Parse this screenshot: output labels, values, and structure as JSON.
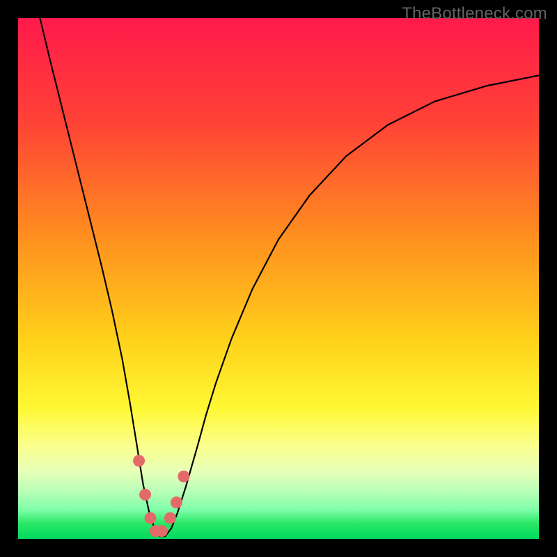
{
  "watermark": "TheBottleneck.com",
  "chart_data": {
    "type": "line",
    "title": "",
    "xlabel": "",
    "ylabel": "",
    "xlim": [
      0,
      1
    ],
    "ylim": [
      0,
      100
    ],
    "background_gradient": {
      "stops": [
        {
          "pos": 0.0,
          "color": "#ff1a4b"
        },
        {
          "pos": 0.2,
          "color": "#ff4236"
        },
        {
          "pos": 0.42,
          "color": "#ff8f1f"
        },
        {
          "pos": 0.62,
          "color": "#ffd21a"
        },
        {
          "pos": 0.75,
          "color": "#fff835"
        },
        {
          "pos": 0.82,
          "color": "#fbff8c"
        },
        {
          "pos": 0.87,
          "color": "#e7ffb7"
        },
        {
          "pos": 0.91,
          "color": "#b7ffb7"
        },
        {
          "pos": 0.945,
          "color": "#7dfda8"
        },
        {
          "pos": 0.97,
          "color": "#2be867"
        },
        {
          "pos": 1.0,
          "color": "#00d85e"
        }
      ]
    },
    "series": [
      {
        "name": "bottleneck-curve",
        "x": [
          0.042,
          0.06,
          0.08,
          0.1,
          0.12,
          0.14,
          0.16,
          0.18,
          0.2,
          0.215,
          0.228,
          0.24,
          0.252,
          0.262,
          0.272,
          0.282,
          0.294,
          0.306,
          0.322,
          0.345,
          0.36,
          0.38,
          0.41,
          0.45,
          0.5,
          0.56,
          0.63,
          0.71,
          0.8,
          0.9,
          1.0
        ],
        "y": [
          100.0,
          92.5,
          84.5,
          76.5,
          68.5,
          60.5,
          52.5,
          44.0,
          34.5,
          26.0,
          18.0,
          10.5,
          5.0,
          2.0,
          0.5,
          0.5,
          2.0,
          5.0,
          10.0,
          18.0,
          23.5,
          30.0,
          38.5,
          48.0,
          57.5,
          66.0,
          73.5,
          79.5,
          84.0,
          87.0,
          89.0
        ]
      }
    ],
    "markers": {
      "name": "highlight-dots",
      "color": "#e46a6a",
      "points": [
        {
          "x": 0.232,
          "y": 15.0
        },
        {
          "x": 0.244,
          "y": 8.5
        },
        {
          "x": 0.254,
          "y": 4.0
        },
        {
          "x": 0.264,
          "y": 1.5
        },
        {
          "x": 0.276,
          "y": 1.5
        },
        {
          "x": 0.292,
          "y": 4.0
        },
        {
          "x": 0.304,
          "y": 7.0
        },
        {
          "x": 0.318,
          "y": 12.0
        }
      ]
    }
  }
}
